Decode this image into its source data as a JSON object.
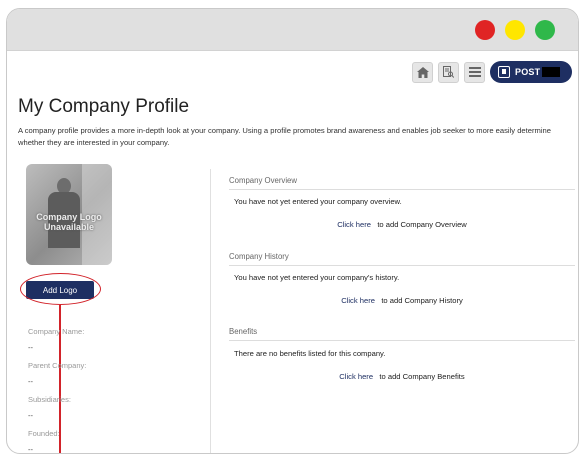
{
  "toolbar": {
    "home_icon": "home-icon",
    "search_doc_icon": "search-document-icon",
    "list_icon": "list-icon",
    "post_label": "POST"
  },
  "page": {
    "title": "My Company Profile",
    "description": "A company profile provides a more in-depth look at your company. Using a profile promotes brand awareness and enables job seeker to more easily determine whether they are interested in your company."
  },
  "logo": {
    "placeholder_text_line1": "Company Logo",
    "placeholder_text_line2": "Unavailable",
    "add_button_label": "Add Logo"
  },
  "fields": [
    {
      "label": "Company Name:",
      "value": "--"
    },
    {
      "label": "Parent Company:",
      "value": "--"
    },
    {
      "label": "Subsidiaries:",
      "value": "--"
    },
    {
      "label": "Founded:",
      "value": "--"
    }
  ],
  "sections": {
    "overview": {
      "header": "Company Overview",
      "text": "You have not yet entered your company overview.",
      "link": "Click here",
      "link_suffix": "to add Company Overview"
    },
    "history": {
      "header": "Company History",
      "text": "You have not yet entered your company's history.",
      "link": "Click here",
      "link_suffix": "to add Company History"
    },
    "benefits": {
      "header": "Benefits",
      "text": "There are no benefits listed for this company.",
      "link": "Click here",
      "link_suffix": "to add Company Benefits"
    }
  },
  "colors": {
    "navy": "#1e2f62",
    "highlight_red": "#d2232a",
    "traffic_red": "#e02424",
    "traffic_yellow": "#ffe600",
    "traffic_green": "#2fb84a"
  }
}
